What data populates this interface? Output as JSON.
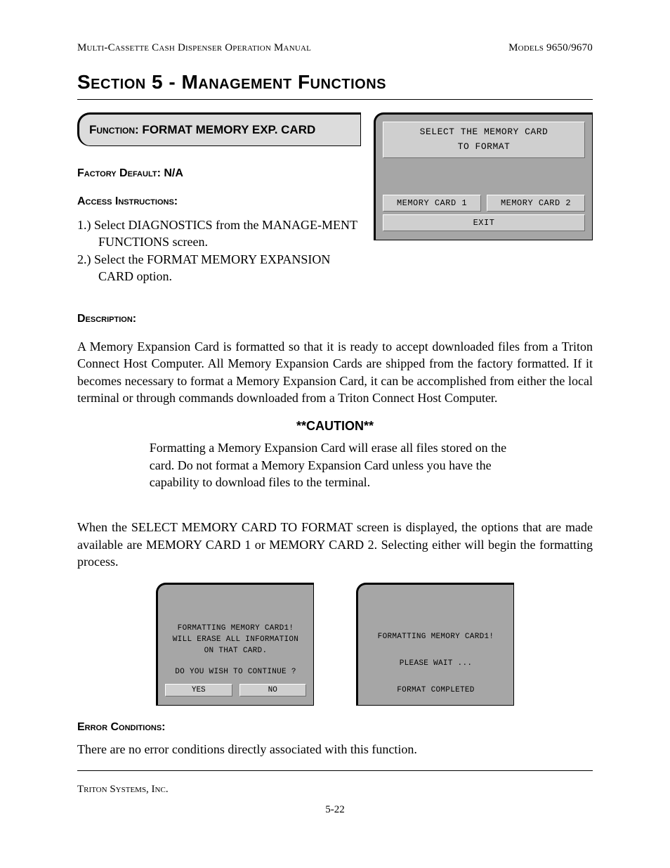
{
  "header": {
    "left": "Multi-Cassette Cash Dispenser Operation Manual",
    "right": "Models 9650/9670"
  },
  "section_title": "Section 5 - Management Functions",
  "function_tab": "Function: FORMAT MEMORY EXP. CARD",
  "factory_default": "Factory Default: N/A",
  "access_label": "Access Instructions:",
  "steps": {
    "s1": "1.) Select DIAGNOSTICS from the MANAGE-MENT FUNCTIONS screen.",
    "s2": "2.) Select the FORMAT MEMORY EXPANSION CARD  option."
  },
  "screen_select": {
    "title_l1": "SELECT THE MEMORY CARD",
    "title_l2": "TO FORMAT",
    "btn_card1": "MEMORY CARD 1",
    "btn_card2": "MEMORY CARD 2",
    "btn_exit": "EXIT"
  },
  "description_label": "Description:",
  "description_body": "A Memory Expansion Card is formatted so that it is ready to accept downloaded files from a Triton Connect Host Computer.  All  Memory Expansion Cards are shipped from the factory formatted.  If it becomes necessary to format a Memory Expansion Card, it can be accomplished from either the local terminal or through commands downloaded from a Triton Connect Host Computer.",
  "caution": {
    "heading": "**CAUTION**",
    "body": "Formatting a Memory Expansion Card will erase all files stored on the card.  Do not format a Memory Expansion Card unless you have the capability to download files to the terminal."
  },
  "select_body": "When the SELECT MEMORY CARD TO FORMAT screen is displayed, the options that are made available are MEMORY CARD 1 or MEMORY CARD 2.  Selecting either will begin the formatting process.",
  "screen_confirm": {
    "l1": "FORMATTING MEMORY CARD1!",
    "l2": "WILL ERASE ALL INFORMATION",
    "l3": "ON THAT CARD.",
    "l4": "DO YOU WISH TO CONTINUE ?",
    "btn_yes": "YES",
    "btn_no": "NO"
  },
  "screen_wait": {
    "l1": "FORMATTING MEMORY CARD1!",
    "l2": "PLEASE WAIT ...",
    "l3": "FORMAT COMPLETED"
  },
  "error_label": "Error Conditions:",
  "error_body": "There are no error conditions directly associated with this function.",
  "footer": "Triton Systems, Inc.",
  "page_num": "5-22"
}
